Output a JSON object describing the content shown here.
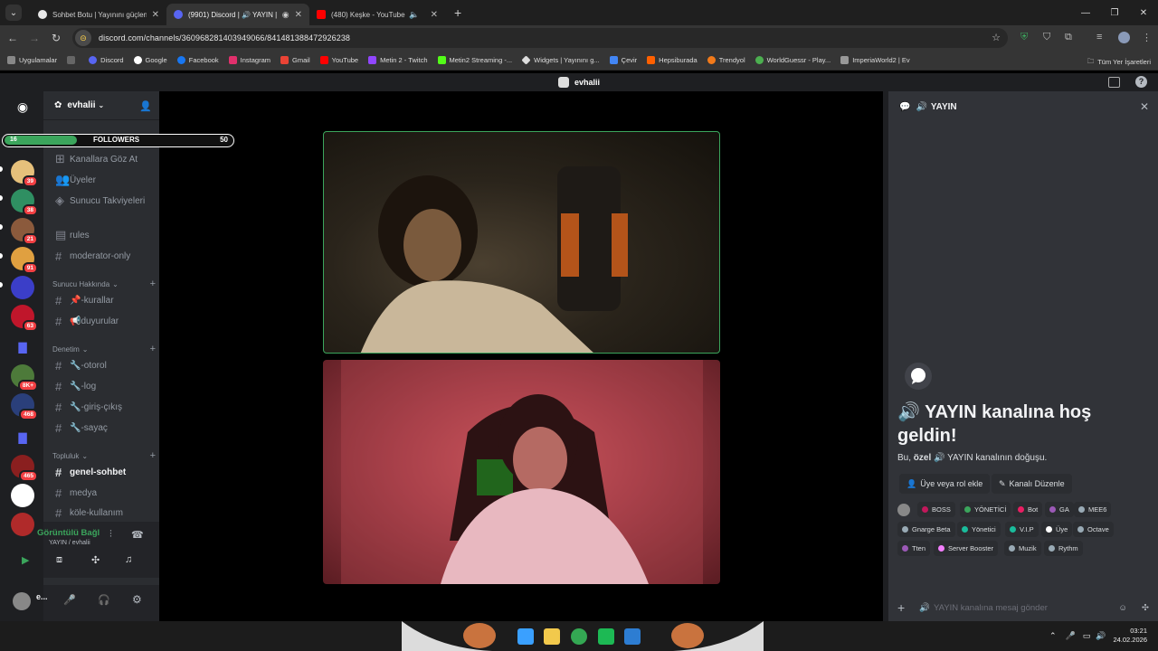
{
  "browser": {
    "tabs": [
      {
        "title": "Sohbet Botu | Yayınını güçlendi...",
        "favicon_color": "#e8e8e8"
      },
      {
        "title": "(9901) Discord | 🔊 YAYIN | ...",
        "favicon_color": "#5865f2"
      },
      {
        "title": "(480) Keşke - YouTube",
        "favicon_color": "#ff0000"
      }
    ],
    "url": "discord.com/channels/360968281403949066/841481388472926238",
    "bookmarks": [
      "Uygulamalar",
      "Discord",
      "Google",
      "Facebook",
      "Instagram",
      "Gmail",
      "YouTube",
      "Metin 2 - Twitch",
      "Metin2 Streaming -...",
      "Widgets | Yayınını g...",
      "Çevir",
      "Hepsiburada",
      "Trendyol",
      "WorldGuessr - Play...",
      "ImperiaWorld2 | Ev"
    ],
    "all_bookmarks": "Tüm Yer İşaretleri"
  },
  "discord": {
    "window_title": "evhalii",
    "server_name": "evhalii",
    "guild_badges": [
      "39",
      "38",
      "21",
      "91",
      "63",
      "8K+",
      "468",
      "465"
    ],
    "channels": [
      {
        "name": "Kanallara Göz At",
        "icon": "browse-icon"
      },
      {
        "name": "Üyeler",
        "icon": "members-icon"
      },
      {
        "name": "Sunucu Takviyeleri",
        "icon": "boost-icon"
      },
      {
        "name": "rules",
        "icon": "rules-icon"
      },
      {
        "name": "moderator-only",
        "icon": "hash"
      }
    ],
    "categories": [
      {
        "name": "Sunucu Hakkında",
        "channels": [
          "📌-kurallar",
          "📢duyurular"
        ]
      },
      {
        "name": "Denetim",
        "channels": [
          "🔧-otorol",
          "🔧-log",
          "🔧-giriş-çıkış",
          "🔧-sayaç"
        ]
      },
      {
        "name": "Topluluk",
        "channels": [
          "genel-sohbet",
          "medya",
          "köle-kullanım"
        ]
      }
    ],
    "active_channel": "genel-sohbet",
    "voice_status": "Görüntülü Bağl",
    "voice_channel": "YAYIN / evhalii",
    "user_name": "e...",
    "followers": {
      "label": "FOLLOWERS",
      "current": "16",
      "goal": "50",
      "progress": 0.32
    },
    "sidebar": {
      "channel_name": "YAYIN",
      "welcome_title": "🔊 YAYIN kanalına hoş geldin!",
      "welcome_prefix": "Bu,",
      "welcome_bold": "özel",
      "welcome_suffix": "🔊 YAYIN kanalının doğuşu.",
      "add_member_btn": "Üye veya rol ekle",
      "edit_channel_btn": "Kanalı Düzenle",
      "roles": [
        {
          "name": "BOSS",
          "color": "#c2185b"
        },
        {
          "name": "YÖNETİCİ",
          "color": "#3ba55c"
        },
        {
          "name": "Bot",
          "color": "#e91e63"
        },
        {
          "name": "GA",
          "color": "#9b59b6"
        },
        {
          "name": "MEE6",
          "color": "#99aab5"
        },
        {
          "name": "Gnarge Beta",
          "color": "#99aab5"
        },
        {
          "name": "Yönetici",
          "color": "#1abc9c"
        },
        {
          "name": "V.I.P",
          "color": "#1abc9c"
        },
        {
          "name": "Üye",
          "color": "#ffffff"
        },
        {
          "name": "Octave",
          "color": "#99aab5"
        },
        {
          "name": "Tten",
          "color": "#9b59b6"
        },
        {
          "name": "Server Booster",
          "color": "#f47fff"
        },
        {
          "name": "Muzik",
          "color": "#99aab5"
        },
        {
          "name": "Rythm",
          "color": "#99aab5"
        }
      ],
      "message_placeholder": "YAYIN kanalına mesaj gönder"
    }
  },
  "taskbar": {
    "time": "03:21",
    "date": "24.02.2026"
  }
}
